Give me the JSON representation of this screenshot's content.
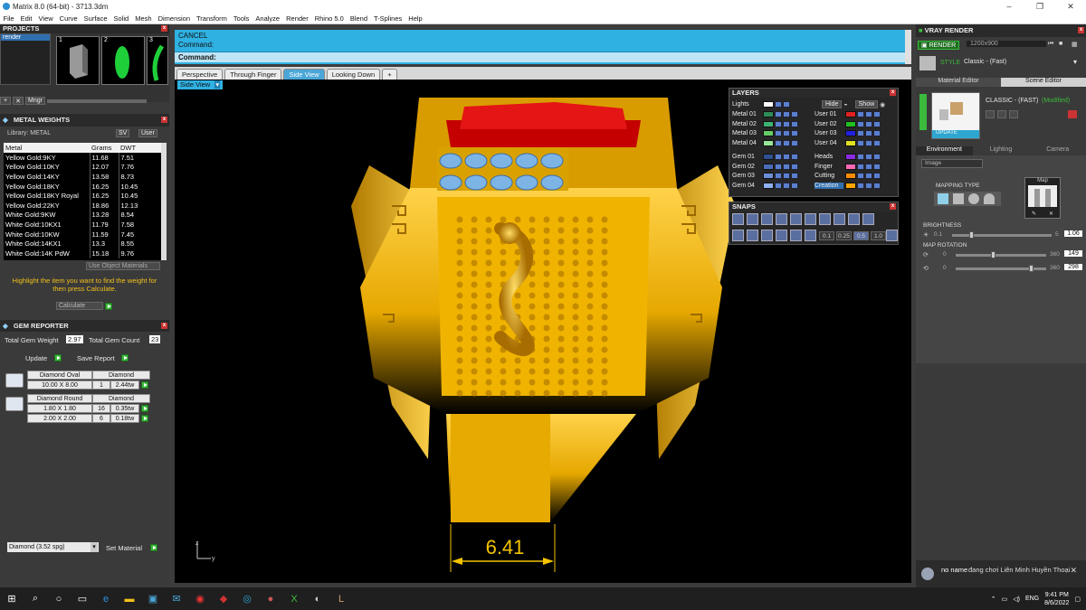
{
  "window": {
    "title": "Matrix 8.0 (64-bit) - 3713.3dm",
    "minimize": "–",
    "maximize": "❐",
    "close": "✕"
  },
  "menu": [
    "File",
    "Edit",
    "View",
    "Curve",
    "Surface",
    "Solid",
    "Mesh",
    "Dimension",
    "Transform",
    "Tools",
    "Analyze",
    "Render",
    "Rhino 5.0",
    "Blend",
    "T-Splines",
    "Help"
  ],
  "projects": {
    "title": "PROJECTS",
    "item": "render",
    "thumb_numbers": [
      "1",
      "2",
      "3"
    ],
    "mngr": "Mngr"
  },
  "metal_weights": {
    "title": "METAL WEIGHTS",
    "library_label": "Library: METAL",
    "sv_label": "SV",
    "user_label": "User",
    "columns": [
      "Metal",
      "Grams",
      "DWT"
    ],
    "rows": [
      [
        "Yellow Gold:9KY",
        "11.68",
        "7.51"
      ],
      [
        "Yellow Gold:10KY",
        "12.07",
        "7.76"
      ],
      [
        "Yellow Gold:14KY",
        "13.58",
        "8.73"
      ],
      [
        "Yellow Gold:18KY",
        "16.25",
        "10.45"
      ],
      [
        "Yellow Gold:18KY Royal",
        "16.25",
        "10.45"
      ],
      [
        "Yellow Gold:22KY",
        "18.86",
        "12.13"
      ],
      [
        "White Gold:9KW",
        "13.28",
        "8.54"
      ],
      [
        "White Gold:10KX1",
        "11.79",
        "7.58"
      ],
      [
        "White Gold:10KW",
        "11.59",
        "7.45"
      ],
      [
        "White Gold:14KX1",
        "13.3",
        "8.55"
      ],
      [
        "White Gold:14K PdW",
        "15.18",
        "9.76"
      ]
    ],
    "use_object_materials": "Use Object Materials",
    "hint": "Highlight the item you want to find the weight for then press Calculate.",
    "calculate": "Calculate"
  },
  "gem_reporter": {
    "title": "GEM REPORTER",
    "total_weight_label": "Total Gem Weight",
    "total_weight": "2.97",
    "total_count_label": "Total Gem Count",
    "total_count": "23",
    "update": "Update",
    "save_report": "Save Report",
    "groups": [
      {
        "name": "Diamond Oval",
        "material": "Diamond",
        "rows": [
          [
            "10.00 X 8.00",
            "1",
            "2.44tw"
          ]
        ]
      },
      {
        "name": "Diamond Round",
        "material": "Diamond",
        "rows": [
          [
            "1.80 X 1.80",
            "16",
            "0.35tw"
          ],
          [
            "2.00 X 2.00",
            "6",
            "0.18tw"
          ]
        ]
      }
    ],
    "material_select": "Diamond      (3.52 spg)",
    "set_material": "Set Material"
  },
  "command": {
    "line1": "CANCEL",
    "line2": "Command:",
    "prompt": "Command:"
  },
  "viewport_tabs": [
    "Perspective",
    "Through Finger",
    "Side View",
    "Looking Down"
  ],
  "active_tab": "Side View",
  "viewport_label": "Side View",
  "dimension_value": "6.41",
  "axis": {
    "z": "z",
    "y": "y"
  },
  "layers": {
    "title": "LAYERS",
    "lights": "Lights",
    "hide": "Hide",
    "show": "Show",
    "left": [
      {
        "name": "Metal 01",
        "color": "#2e8b57"
      },
      {
        "name": "Metal 02",
        "color": "#3cb371"
      },
      {
        "name": "Metal 03",
        "color": "#66cc66"
      },
      {
        "name": "Metal 04",
        "color": "#99e699"
      },
      {
        "name": "Gem 01",
        "color": "#2f4f8f"
      },
      {
        "name": "Gem 02",
        "color": "#4b6cb7"
      },
      {
        "name": "Gem 03",
        "color": "#6a8fd8"
      },
      {
        "name": "Gem 04",
        "color": "#8fb0f0"
      }
    ],
    "right": [
      {
        "name": "User 01",
        "color": "#e02020"
      },
      {
        "name": "User 02",
        "color": "#20c020"
      },
      {
        "name": "User 03",
        "color": "#2020e0"
      },
      {
        "name": "User 04",
        "color": "#e0e020"
      },
      {
        "name": "Heads",
        "color": "#8a2be2"
      },
      {
        "name": "Finger",
        "color": "#ff69b4"
      },
      {
        "name": "Cutting",
        "color": "#ff8c00"
      },
      {
        "name": "Creation",
        "color": "#ffa500"
      }
    ]
  },
  "snaps": {
    "title": "SNAPS",
    "values": [
      "0.1",
      "0.25",
      "0.5",
      "1.0"
    ]
  },
  "vray": {
    "title": "VRAY RENDER",
    "render": "RENDER",
    "resolution": "1200x900",
    "style_label": "STYLE",
    "style_value": "Classic - (Fast)",
    "tabs": [
      "Material Editor",
      "Scene Editor"
    ],
    "preset": "CLASSIC - (FAST)",
    "modified": "(Modified)",
    "update": "UPDATE",
    "env_tabs": [
      "Environment",
      "Lighting",
      "Camera"
    ],
    "image_select": "Image",
    "mapping_type": "MAPPING TYPE",
    "map": "Map",
    "brightness_label": "BRIGHTNESS",
    "brightness_min": "0.1",
    "brightness_max": "5",
    "brightness": "1.06",
    "brightness_value": 0.19,
    "map_rotation_label": "MAP ROTATION",
    "rot1_min": "0",
    "rot1_max": "360",
    "rot1": "149",
    "rot1_value": 0.41,
    "rot2_min": "0",
    "rot2_max": "360",
    "rot2": "298",
    "rot2_value": 0.83
  },
  "notification": {
    "user": "no name",
    "text": "đang chơi Liên Minh Huyền Thoại"
  },
  "taskbar": {
    "lang": "ENG",
    "time": "9:41 PM",
    "date": "8/6/2022"
  }
}
